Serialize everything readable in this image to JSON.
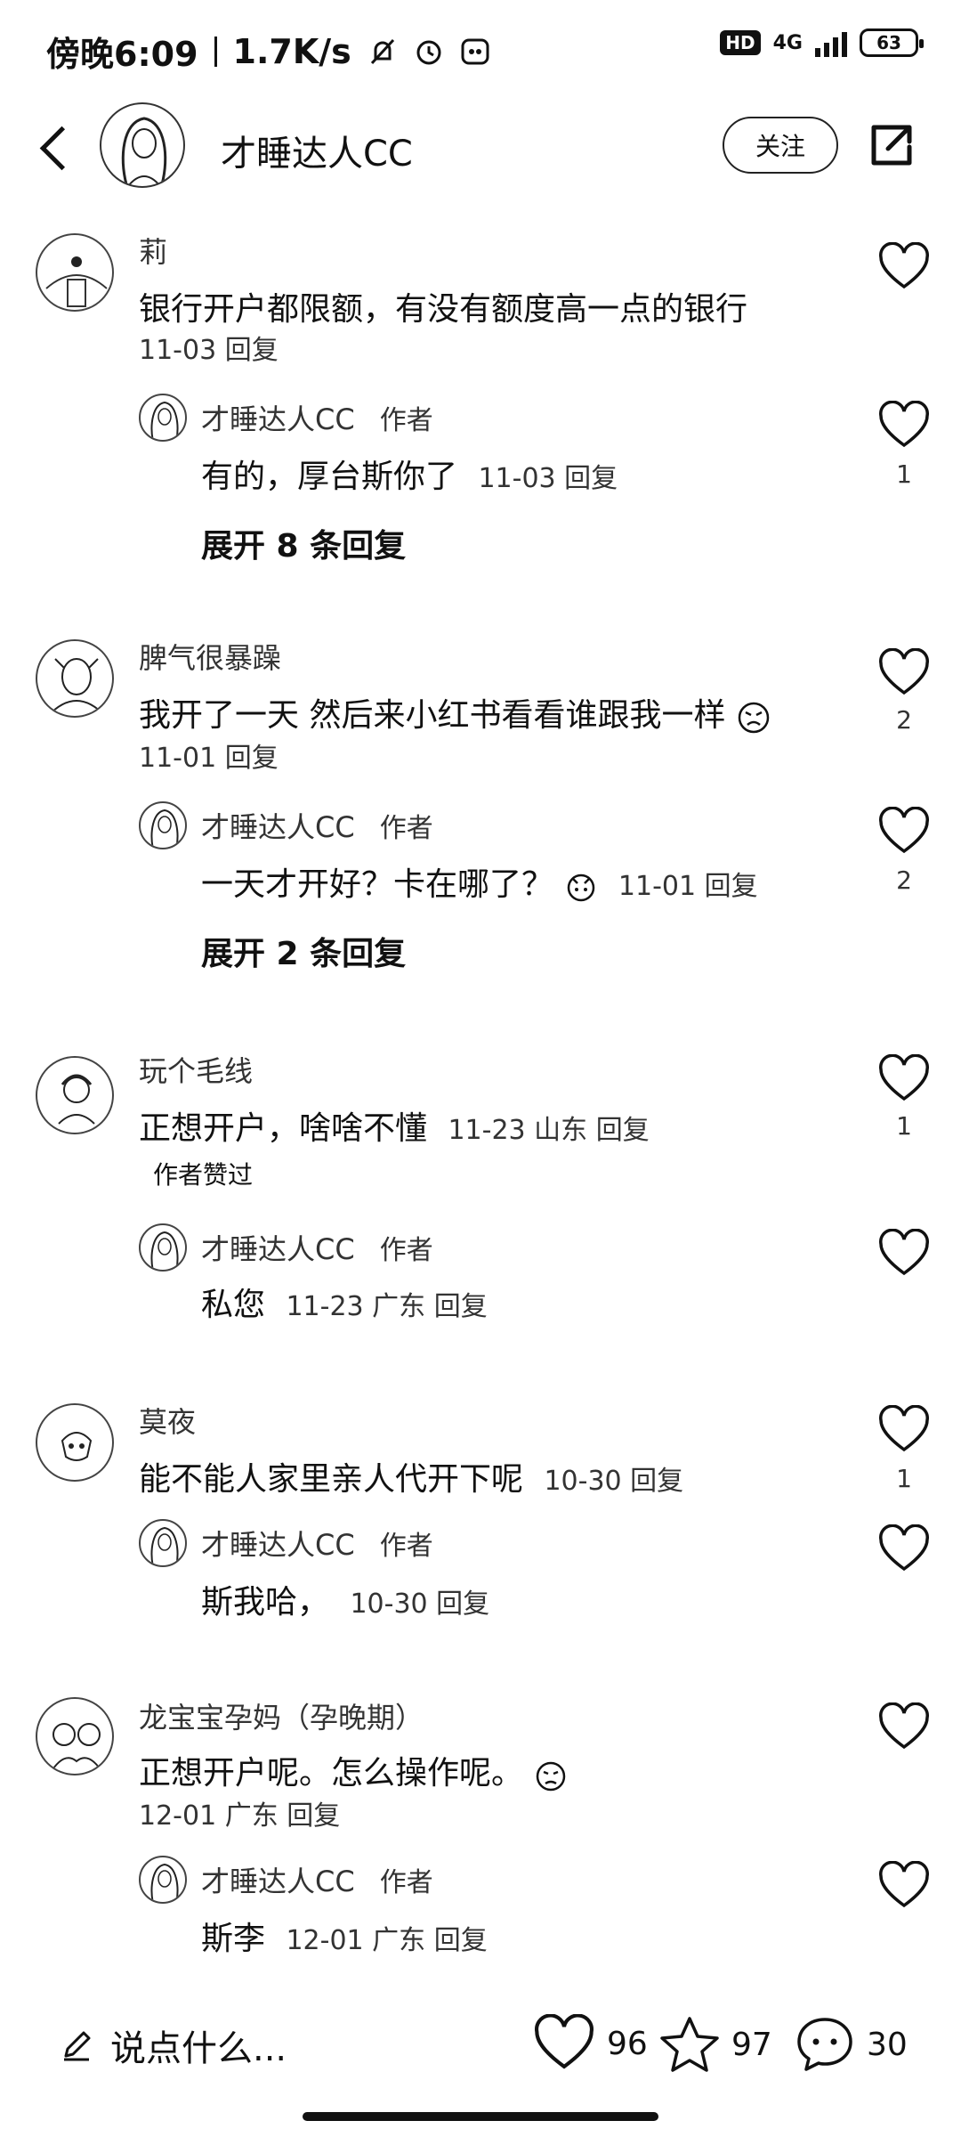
{
  "status": {
    "time": "傍晚6:09",
    "speed": "1.7K/s",
    "hd": "HD",
    "net": "4G",
    "battery": "63"
  },
  "header": {
    "title": "才睡达人CC",
    "follow": "关注"
  },
  "comments": [
    {
      "name": "莉",
      "text": "银行开户都限额，有没有额度高一点的银行",
      "meta": "11-03  回复",
      "likes": "",
      "reply": {
        "name": "才睡达人CC",
        "tag": "作者",
        "text": "有的，厚台斯你了",
        "meta": "11-03  回复",
        "likes": "1"
      },
      "expand": "展开 8 条回复"
    },
    {
      "name": "脾气很暴躁",
      "text": "我开了一天 然后来小红书看看谁跟我一样",
      "meta": "11-01  回复",
      "likes": "2",
      "reply": {
        "name": "才睡达人CC",
        "tag": "作者",
        "text": "一天才开好？卡在哪了？",
        "meta": "11-01  回复",
        "likes": "2"
      },
      "expand": "展开 2 条回复"
    },
    {
      "name": "玩个毛线",
      "text": "正想开户，啥啥不懂",
      "meta": "11-23 山东 回复",
      "liked": "作者赞过",
      "likes": "1",
      "reply": {
        "name": "才睡达人CC",
        "tag": "作者",
        "text": "私您",
        "meta": "11-23 广东 回复",
        "likes": ""
      }
    },
    {
      "name": "莫夜",
      "text": "能不能人家里亲人代开下呢",
      "meta": "10-30  回复",
      "likes": "1",
      "reply": {
        "name": "才睡达人CC",
        "tag": "作者",
        "text": "斯我哈，",
        "meta": "10-30  回复",
        "likes": ""
      }
    },
    {
      "name": "龙宝宝孕妈（孕晚期）",
      "text": "正想开户呢。怎么操作呢。",
      "meta": "12-01 广东 回复",
      "likes": "",
      "reply": {
        "name": "才睡达人CC",
        "tag": "作者",
        "text": "斯李",
        "meta": "12-01 广东 回复",
        "likes": ""
      }
    }
  ],
  "bottom": {
    "placeholder": "说点什么...",
    "likes": "96",
    "stars": "97",
    "comments": "30"
  },
  "icons": {
    "like": "heart-icon",
    "star": "star-icon",
    "comment": "chat-bubble-icon",
    "edit": "pencil-icon",
    "share": "share-icon",
    "back": "back-arrow-icon"
  }
}
